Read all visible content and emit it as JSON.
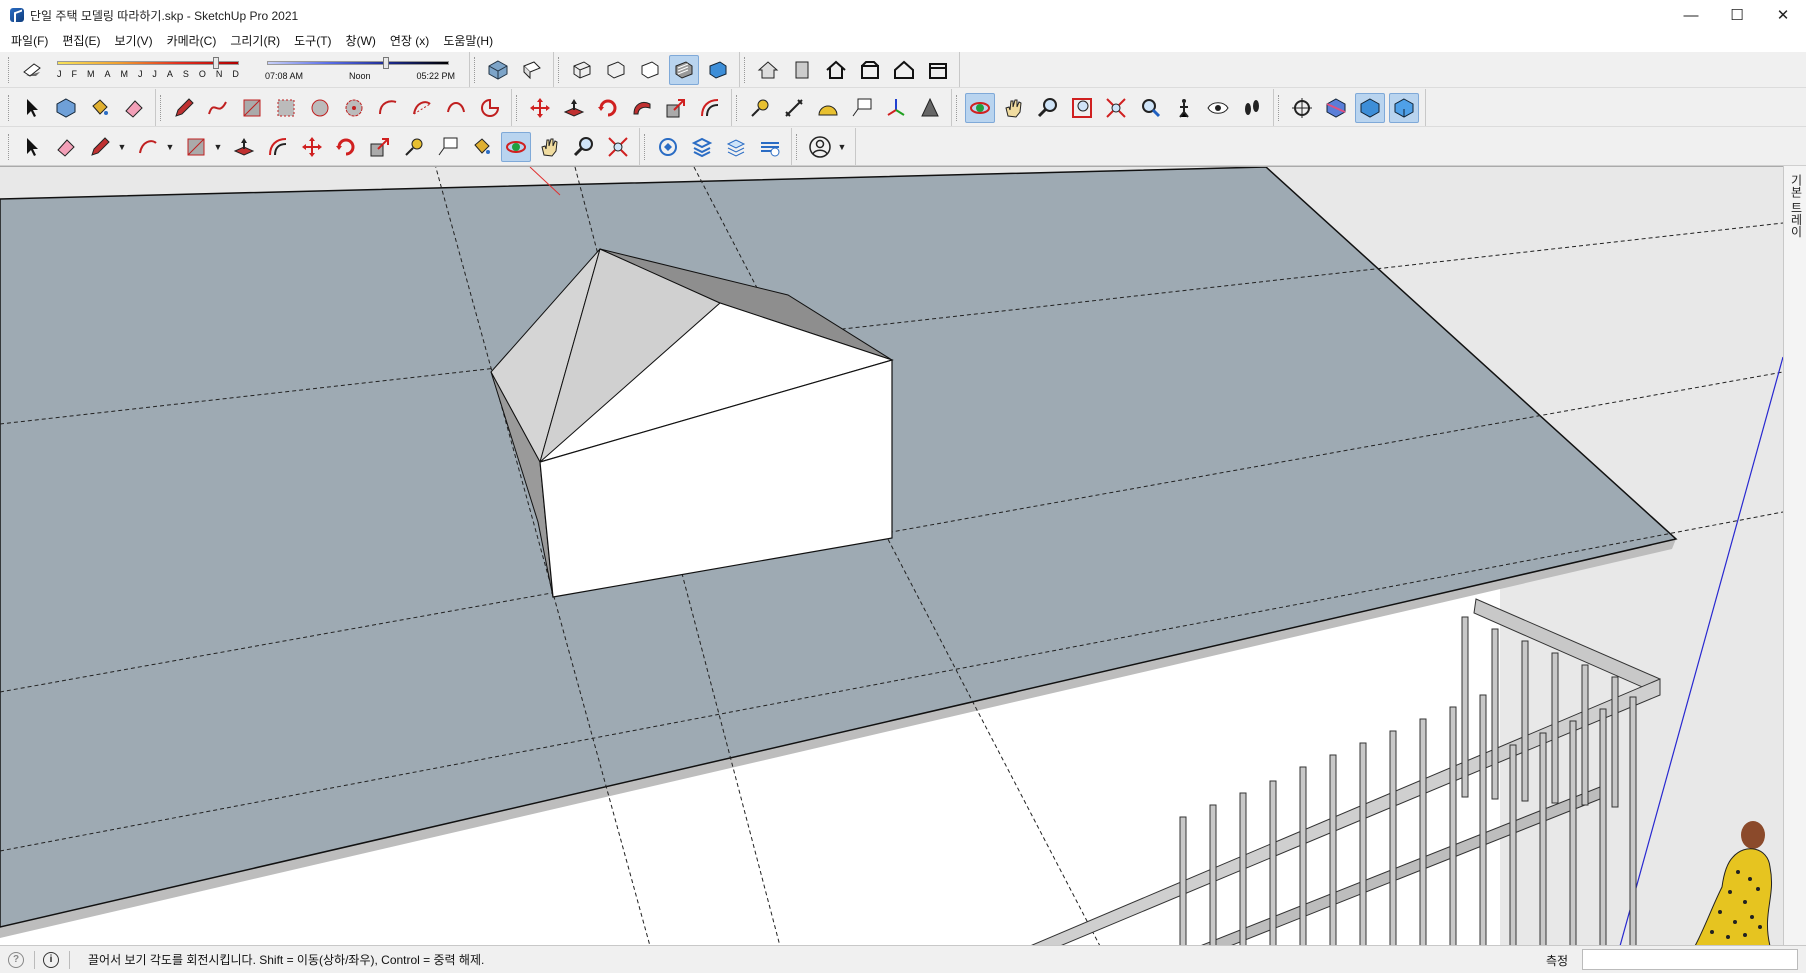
{
  "window": {
    "title": "단일 주택 모델링 따라하기.skp - SketchUp Pro 2021",
    "minimize": "—",
    "maximize": "☐",
    "close": "✕"
  },
  "menu": [
    "파일(F)",
    "편집(E)",
    "보기(V)",
    "카메라(C)",
    "그리기(R)",
    "도구(T)",
    "창(W)",
    "연장 (x)",
    "도움말(H)"
  ],
  "shadow": {
    "months": [
      "J",
      "F",
      "M",
      "A",
      "M",
      "J",
      "J",
      "A",
      "S",
      "O",
      "N",
      "D"
    ],
    "month_value": 11,
    "time_start": "07:08 AM",
    "time_mid": "Noon",
    "time_end": "05:22 PM"
  },
  "toolbars": {
    "row1": [
      "views-iso-icon",
      "views-top-icon",
      "views-front-icon",
      "views-right-icon",
      "views-back-icon",
      "views-left-icon",
      "style-xray-icon",
      "style-wireframe-icon",
      "style-hidden-line-icon",
      "style-shaded-icon",
      "style-textured-icon",
      "style-monochrome-icon",
      "house-icon",
      "building-icon"
    ],
    "row2": [
      "select-icon",
      "component-icon",
      "paint-bucket-icon",
      "eraser-icon",
      "pencil-icon",
      "freehand-icon",
      "rectangle-icon",
      "rotated-rectangle-icon",
      "circle-icon",
      "polygon-icon",
      "arc-icon",
      "two-point-arc-icon",
      "three-point-arc-icon",
      "pie-icon",
      "move-icon",
      "push-pull-icon",
      "rotate-icon",
      "follow-me-icon",
      "scale-icon",
      "offset-icon",
      "tape-measure-icon",
      "dimension-icon",
      "protractor-icon",
      "text-icon",
      "axes-icon",
      "3d-text-icon",
      "orbit-icon",
      "pan-icon",
      "zoom-icon",
      "zoom-window-icon",
      "zoom-extents-icon",
      "previous-view-icon",
      "position-camera-icon",
      "look-around-icon",
      "walk-icon",
      "section-plane-icon",
      "section-display-icon",
      "section-cut-icon",
      "section-fill-icon"
    ],
    "row3": [
      "select-icon",
      "eraser-icon",
      "line-icon",
      "arc-icon",
      "rectangle-icon",
      "push-pull-icon",
      "move-icon",
      "rotate-icon",
      "scale-icon",
      "tape-measure-icon",
      "text-icon",
      "paint-bucket-icon",
      "orbit-icon",
      "pan-icon",
      "zoom-icon",
      "zoom-extents-icon",
      "warehouse-icon",
      "extension-icon",
      "layers-icon",
      "sandbox-icon",
      "account-icon"
    ],
    "active_row2": "orbit-icon",
    "active_row3": "orbit-icon"
  },
  "tray": {
    "label": "기본 트레이"
  },
  "status": {
    "hint": "끌어서 보기 각도를 회전시킵니다. Shift = 이동(상하/좌우), Control = 중력 해제.",
    "measure_label": "측정",
    "measure_value": ""
  },
  "colors": {
    "roof": "#9eaab3",
    "ground": "#e8e8e8",
    "wall": "#ffffff",
    "dormer_roof_light": "#d5d5d5",
    "dormer_roof_dark": "#8e8e8e",
    "blue_axis": "#2828d0",
    "red_axis": "#e03030"
  }
}
